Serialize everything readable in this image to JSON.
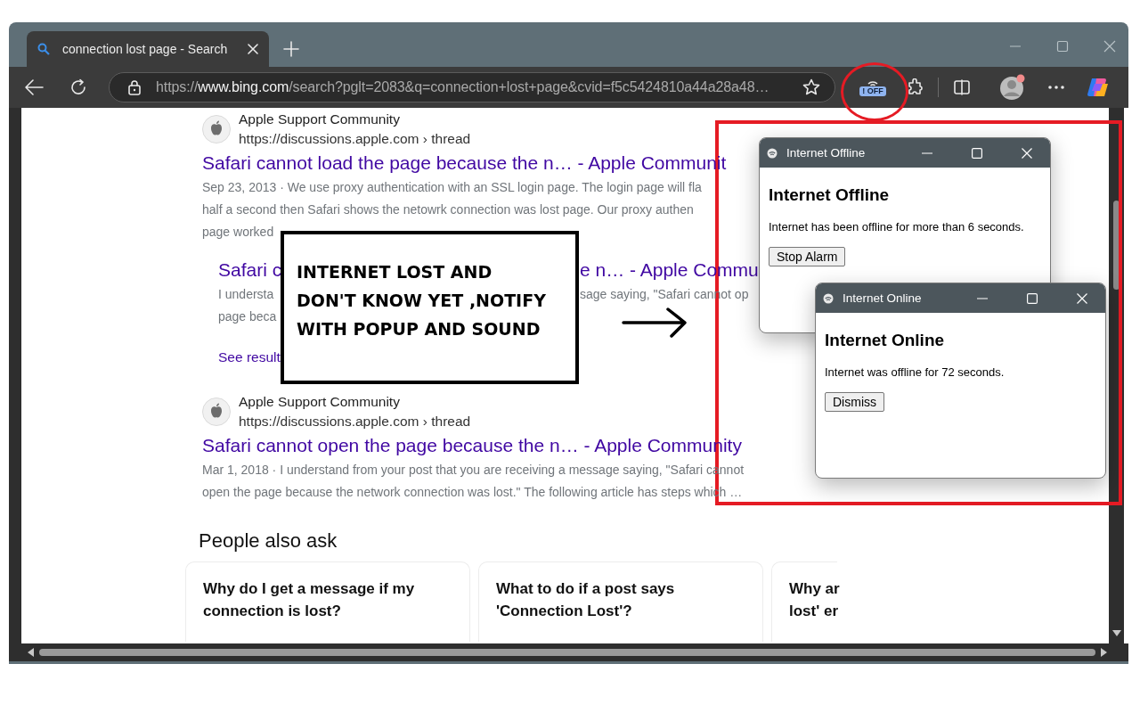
{
  "browser": {
    "tabs": [
      {
        "title": "connection lost page - Search",
        "selected": true
      }
    ],
    "address": {
      "scheme": "https://",
      "host": "www.bing.com",
      "path": "/search?pglt=2083&q=connection+lost+page&cvid=f5c5424810a44a28a48…"
    },
    "extension_badge": "! OFF"
  },
  "results": [
    {
      "kind": "result",
      "source": "Apple Support Community",
      "url": "https://discussions.apple.com › thread",
      "title": "Safari cannot load the page because the n… - Apple Communit",
      "snippet": [
        "Sep 23, 2013 · We use proxy authentication with an SSL login page. The login page will fla",
        "half a second then Safari shows the netowrk connection was lost page. Our proxy authen",
        "page worked"
      ]
    },
    {
      "kind": "subresult",
      "title": [
        "Safari c",
        "e n… - Apple Commu"
      ],
      "snippet": [
        [
          "I understa",
          "sage saying, \"Safari cannot op"
        ],
        [
          "page beca"
        ]
      ],
      "link": "See result"
    },
    {
      "kind": "result",
      "source": "Apple Support Community",
      "url": "https://discussions.apple.com › thread",
      "title": "Safari cannot open the page because the n… - Apple Community",
      "snippet": [
        "Mar 1, 2018 · I understand from your post that you are receiving a message saying, \"Safari cannot",
        "open the page because the network connection was lost.\" The following article has steps which …"
      ]
    }
  ],
  "people_also_ask": {
    "heading": "People also ask",
    "cards": [
      {
        "lines": [
          "Why do I get a message if my",
          "connection is lost?"
        ]
      },
      {
        "lines": [
          "What to do if a post says",
          "'Connection Lost'?"
        ]
      },
      {
        "lines": [
          "Why ar",
          "lost' er"
        ]
      }
    ]
  },
  "annotation": {
    "note": [
      "INTERNET LOST AND",
      "DON'T KNOW YET ,NOTIFY",
      "WITH POPUP AND SOUND"
    ]
  },
  "popups": [
    {
      "title": "Internet Offline",
      "heading": "Internet Offline",
      "message": "Internet has been offline for more than 6 seconds.",
      "button": "Stop Alarm"
    },
    {
      "title": "Internet Online",
      "heading": "Internet Online",
      "message": "Internet was offline for 72 seconds.",
      "button": "Dismiss"
    }
  ]
}
